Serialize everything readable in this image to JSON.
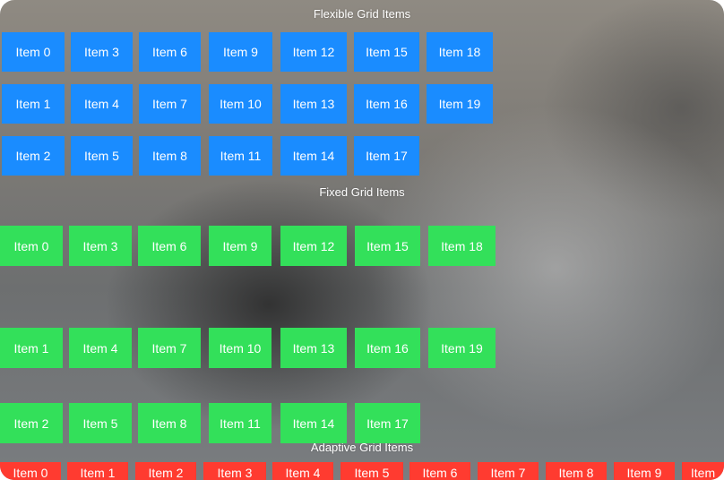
{
  "sections": {
    "flexible_title": "Flexible Grid Items",
    "fixed_title": "Fixed Grid Items",
    "adaptive_title": "Adaptive Grid Items"
  },
  "flexible_items": [
    "Item 0",
    "Item 1",
    "Item 2",
    "Item 3",
    "Item 4",
    "Item 5",
    "Item 6",
    "Item 7",
    "Item 8",
    "Item 9",
    "Item 10",
    "Item 11",
    "Item 12",
    "Item 13",
    "Item 14",
    "Item 15",
    "Item 16",
    "Item 17",
    "Item 18",
    "Item 19"
  ],
  "fixed_items": [
    "Item 0",
    "Item 1",
    "Item 2",
    "Item 3",
    "Item 4",
    "Item 5",
    "Item 6",
    "Item 7",
    "Item 8",
    "Item 9",
    "Item 10",
    "Item 11",
    "Item 12",
    "Item 13",
    "Item 14",
    "Item 15",
    "Item 16",
    "Item 17",
    "Item 18",
    "Item 19"
  ],
  "adaptive_items": [
    "Item 0",
    "Item 1",
    "Item 2",
    "Item 3",
    "Item 4",
    "Item 5",
    "Item 6",
    "Item 7",
    "Item 8",
    "Item 9",
    "Item"
  ],
  "colors": {
    "flexible": "#1a8cff",
    "fixed": "#33e05a",
    "adaptive": "#ff3b30"
  }
}
